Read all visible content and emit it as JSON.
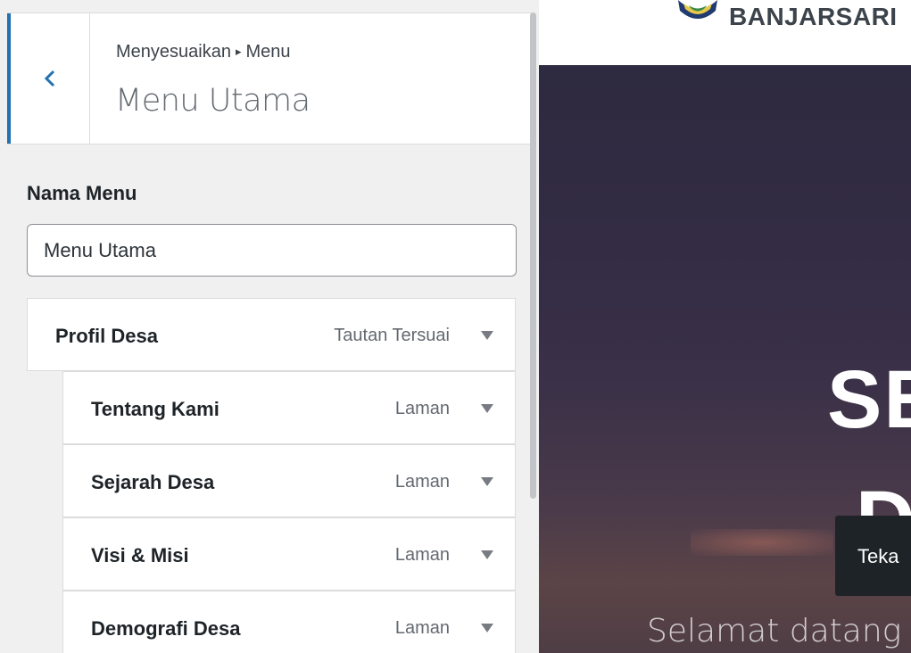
{
  "customizer": {
    "breadcrumb": {
      "parent": "Menyesuaikan",
      "separator": "▸",
      "current": "Menu"
    },
    "title": "Menu Utama",
    "menu_name_label": "Nama Menu",
    "menu_name_value": "Menu Utama",
    "menu_items": [
      {
        "title": "Profil Desa",
        "type": "Tautan Tersuai",
        "depth": 0
      },
      {
        "title": "Tentang Kami",
        "type": "Laman",
        "depth": 1
      },
      {
        "title": "Sejarah Desa",
        "type": "Laman",
        "depth": 1
      },
      {
        "title": "Visi & Misi",
        "type": "Laman",
        "depth": 1
      },
      {
        "title": "Demografi Desa",
        "type": "Laman",
        "depth": 1
      }
    ],
    "icons": {
      "back": "chevron-left-icon",
      "expand": "caret-down-icon"
    },
    "colors": {
      "accent": "#2271b1",
      "panel_bg": "#f0f0f1"
    }
  },
  "preview": {
    "site_name": "BANJARSARI",
    "hero_line1": "SE",
    "hero_line2": "D",
    "hero_subtitle": "Selamat datang di",
    "tooltip": "Teka"
  }
}
